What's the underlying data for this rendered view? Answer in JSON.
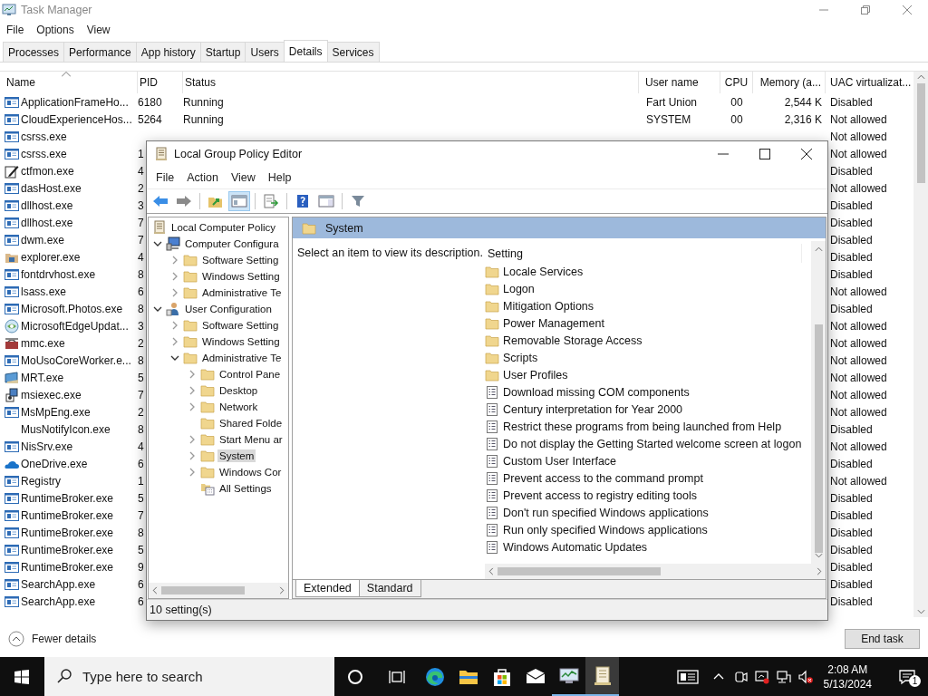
{
  "task_manager": {
    "title": "Task Manager",
    "menu": [
      "File",
      "Options",
      "View"
    ],
    "tabs": [
      {
        "label": "Processes",
        "selected": false
      },
      {
        "label": "Performance",
        "selected": false
      },
      {
        "label": "App history",
        "selected": false
      },
      {
        "label": "Startup",
        "selected": false
      },
      {
        "label": "Users",
        "selected": false
      },
      {
        "label": "Details",
        "selected": true
      },
      {
        "label": "Services",
        "selected": false
      }
    ],
    "columns": [
      "Name",
      "PID",
      "Status",
      "User name",
      "CPU",
      "Memory (a...",
      "UAC virtualizat..."
    ],
    "rows": [
      {
        "kind": "app",
        "name": "ApplicationFrameHo...",
        "pid": "6180",
        "status": "Running",
        "user": "Fart Union",
        "cpu": "00",
        "memory": "2,544 K",
        "uac": "Disabled"
      },
      {
        "kind": "app",
        "name": "CloudExperienceHos...",
        "pid": "5264",
        "status": "Running",
        "user": "SYSTEM",
        "cpu": "00",
        "memory": "2,316 K",
        "uac": "Not allowed"
      },
      {
        "kind": "app",
        "name": "csrss.exe",
        "uac": "Not allowed"
      },
      {
        "kind": "app",
        "name": "csrss.exe",
        "pid": "1",
        "uac": "Not allowed"
      },
      {
        "kind": "pen",
        "name": "ctfmon.exe",
        "pid": "4",
        "uac": "Disabled"
      },
      {
        "kind": "app",
        "name": "dasHost.exe",
        "pid": "2",
        "uac": "Not allowed"
      },
      {
        "kind": "app",
        "name": "dllhost.exe",
        "pid": "3",
        "uac": "Disabled"
      },
      {
        "kind": "app",
        "name": "dllhost.exe",
        "pid": "7",
        "uac": "Disabled"
      },
      {
        "kind": "app",
        "name": "dwm.exe",
        "pid": "7",
        "uac": "Disabled"
      },
      {
        "kind": "folder",
        "name": "explorer.exe",
        "pid": "4",
        "uac": "Disabled"
      },
      {
        "kind": "app",
        "name": "fontdrvhost.exe",
        "pid": "8",
        "uac": "Disabled"
      },
      {
        "kind": "app",
        "name": "lsass.exe",
        "pid": "6",
        "uac": "Not allowed"
      },
      {
        "kind": "app",
        "name": "Microsoft.Photos.exe",
        "pid": "8",
        "uac": "Disabled"
      },
      {
        "kind": "globe",
        "name": "MicrosoftEdgeUpdat...",
        "pid": "3",
        "uac": "Not allowed"
      },
      {
        "kind": "toolbox",
        "name": "mmc.exe",
        "pid": "2",
        "uac": "Not allowed"
      },
      {
        "kind": "app",
        "name": "MoUsoCoreWorker.e...",
        "pid": "8",
        "uac": "Not allowed"
      },
      {
        "kind": "monitor",
        "name": "MRT.exe",
        "pid": "5",
        "uac": "Not allowed"
      },
      {
        "kind": "package",
        "name": "msiexec.exe",
        "pid": "7",
        "uac": "Not allowed"
      },
      {
        "kind": "app",
        "name": "MsMpEng.exe",
        "pid": "2",
        "uac": "Not allowed"
      },
      {
        "kind": "plain",
        "name": "MusNotifyIcon.exe",
        "pid": "8",
        "uac": "Disabled"
      },
      {
        "kind": "app",
        "name": "NisSrv.exe",
        "pid": "4",
        "uac": "Not allowed"
      },
      {
        "kind": "cloud",
        "name": "OneDrive.exe",
        "pid": "6",
        "uac": "Disabled"
      },
      {
        "kind": "app",
        "name": "Registry",
        "pid": "1",
        "uac": "Not allowed"
      },
      {
        "kind": "app",
        "name": "RuntimeBroker.exe",
        "pid": "5",
        "uac": "Disabled"
      },
      {
        "kind": "app",
        "name": "RuntimeBroker.exe",
        "pid": "7",
        "uac": "Disabled"
      },
      {
        "kind": "app",
        "name": "RuntimeBroker.exe",
        "pid": "8",
        "uac": "Disabled"
      },
      {
        "kind": "app",
        "name": "RuntimeBroker.exe",
        "pid": "5",
        "uac": "Disabled"
      },
      {
        "kind": "app",
        "name": "RuntimeBroker.exe",
        "pid": "9",
        "uac": "Disabled"
      },
      {
        "kind": "app",
        "name": "SearchApp.exe",
        "pid": "6",
        "uac": "Disabled"
      },
      {
        "kind": "app",
        "name": "SearchApp.exe",
        "pid": "6",
        "uac": "Disabled"
      }
    ],
    "fewer_details": "Fewer details",
    "end_task": "End task"
  },
  "policy_editor": {
    "title": "Local Group Policy Editor",
    "menu": [
      "File",
      "Action",
      "View",
      "Help"
    ],
    "tree": [
      {
        "kind": "policy",
        "label": "Local Computer Policy",
        "selected": false,
        "children": [
          {
            "kind": "computer",
            "label": "Computer Configura",
            "expanded": true,
            "selected": false,
            "children": [
              {
                "kind": "folder",
                "label": "Software Setting",
                "expanded": false,
                "selected": false
              },
              {
                "kind": "folder",
                "label": "Windows Setting",
                "expanded": false,
                "selected": false
              },
              {
                "kind": "folder",
                "label": "Administrative Te",
                "expanded": false,
                "selected": false
              }
            ]
          },
          {
            "kind": "user",
            "label": "User Configuration",
            "expanded": true,
            "selected": false,
            "children": [
              {
                "kind": "folder",
                "label": "Software Setting",
                "expanded": false,
                "selected": false
              },
              {
                "kind": "folder",
                "label": "Windows Setting",
                "expanded": false,
                "selected": false
              },
              {
                "kind": "folder",
                "label": "Administrative Te",
                "expanded": true,
                "selected": false,
                "children": [
                  {
                    "kind": "folder",
                    "label": "Control Pane",
                    "expanded": false,
                    "selected": false
                  },
                  {
                    "kind": "folder",
                    "label": "Desktop",
                    "expanded": false,
                    "selected": false
                  },
                  {
                    "kind": "folder",
                    "label": "Network",
                    "expanded": false,
                    "selected": false
                  },
                  {
                    "kind": "folder",
                    "label": "Shared Folde",
                    "selected": false
                  },
                  {
                    "kind": "folder",
                    "label": "Start Menu ar",
                    "expanded": false,
                    "selected": false
                  },
                  {
                    "kind": "folder",
                    "label": "System",
                    "expanded": false,
                    "selected": true
                  },
                  {
                    "kind": "folder",
                    "label": "Windows Cor",
                    "expanded": false,
                    "selected": false
                  },
                  {
                    "kind": "all",
                    "label": "All Settings",
                    "selected": false
                  }
                ]
              }
            ]
          }
        ]
      }
    ],
    "heading": "System",
    "description": "Select an item to view its description.",
    "column": "Setting",
    "settings": [
      {
        "kind": "folder",
        "label": "Locale Services"
      },
      {
        "kind": "folder",
        "label": "Logon"
      },
      {
        "kind": "folder",
        "label": "Mitigation Options"
      },
      {
        "kind": "folder",
        "label": "Power Management"
      },
      {
        "kind": "folder",
        "label": "Removable Storage Access"
      },
      {
        "kind": "folder",
        "label": "Scripts"
      },
      {
        "kind": "folder",
        "label": "User Profiles"
      },
      {
        "kind": "policy",
        "label": "Download missing COM components"
      },
      {
        "kind": "policy",
        "label": "Century interpretation for Year 2000"
      },
      {
        "kind": "policy",
        "label": "Restrict these programs from being launched from Help"
      },
      {
        "kind": "policy",
        "label": "Do not display the Getting Started welcome screen at logon"
      },
      {
        "kind": "policy",
        "label": "Custom User Interface"
      },
      {
        "kind": "policy",
        "label": "Prevent access to the command prompt"
      },
      {
        "kind": "policy",
        "label": "Prevent access to registry editing tools"
      },
      {
        "kind": "policy",
        "label": "Don't run specified Windows applications"
      },
      {
        "kind": "policy",
        "label": "Run only specified Windows applications"
      },
      {
        "kind": "policy",
        "label": "Windows Automatic Updates"
      }
    ],
    "tabs": [
      {
        "label": "Extended",
        "selected": true
      },
      {
        "label": "Standard",
        "selected": false
      }
    ],
    "status": "10 setting(s)"
  },
  "taskbar": {
    "search_placeholder": "Type here to search",
    "apps": [
      {
        "kind": "browser",
        "running": false,
        "selected": false
      },
      {
        "kind": "files",
        "running": false,
        "selected": false
      },
      {
        "kind": "store",
        "running": false,
        "selected": false
      },
      {
        "kind": "mail",
        "running": false,
        "selected": false
      },
      {
        "kind": "taskmgr",
        "running": true,
        "selected": false
      },
      {
        "kind": "gpedit",
        "running": true,
        "selected": true
      }
    ],
    "time": "2:08 AM",
    "date": "5/13/2024",
    "notifications": "1"
  }
}
